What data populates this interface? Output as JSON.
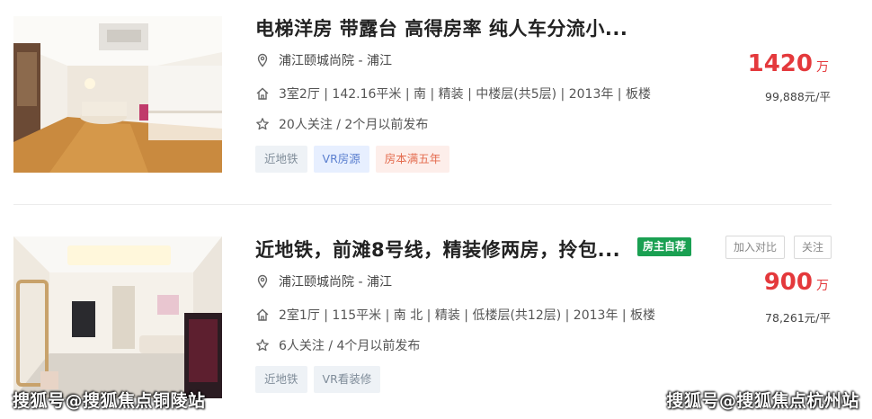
{
  "listings": [
    {
      "title": "电梯洋房 带露台 高得房率 纯人车分流小...",
      "location": "浦江颐城尚院 - 浦江",
      "info": "3室2厅 | 142.16平米 | 南 | 精装 | 中楼层(共5层) | 2013年 | 板楼",
      "follow": "20人关注 / 2个月以前发布",
      "tags": [
        "近地铁",
        "VR房源",
        "房本满五年"
      ],
      "price": "1420",
      "price_unit": "万",
      "unit_price": "99,888元/平"
    },
    {
      "title": "近地铁，前滩8号线，精装修两房，拎包...",
      "owner_badge": "房主自荐",
      "location": "浦江颐城尚院 - 浦江",
      "info": "2室1厅 | 115平米 | 南 北 | 精装 | 低楼层(共12层) | 2013年 | 板楼",
      "follow": "6人关注 / 4个月以前发布",
      "tags": [
        "近地铁",
        "VR看装修"
      ],
      "price": "900",
      "price_unit": "万",
      "unit_price": "78,261元/平",
      "buttons": {
        "compare": "加入对比",
        "follow": "关注"
      }
    }
  ],
  "watermarks": {
    "left": "搜狐号@搜狐焦点铜陵站",
    "right": "搜狐号@搜狐焦点杭州站"
  },
  "colors": {
    "price": "#e4393c",
    "owner_badge": "#1aa052",
    "tag_blue": "#5b7fcf",
    "tag_red": "#e46c4f"
  }
}
